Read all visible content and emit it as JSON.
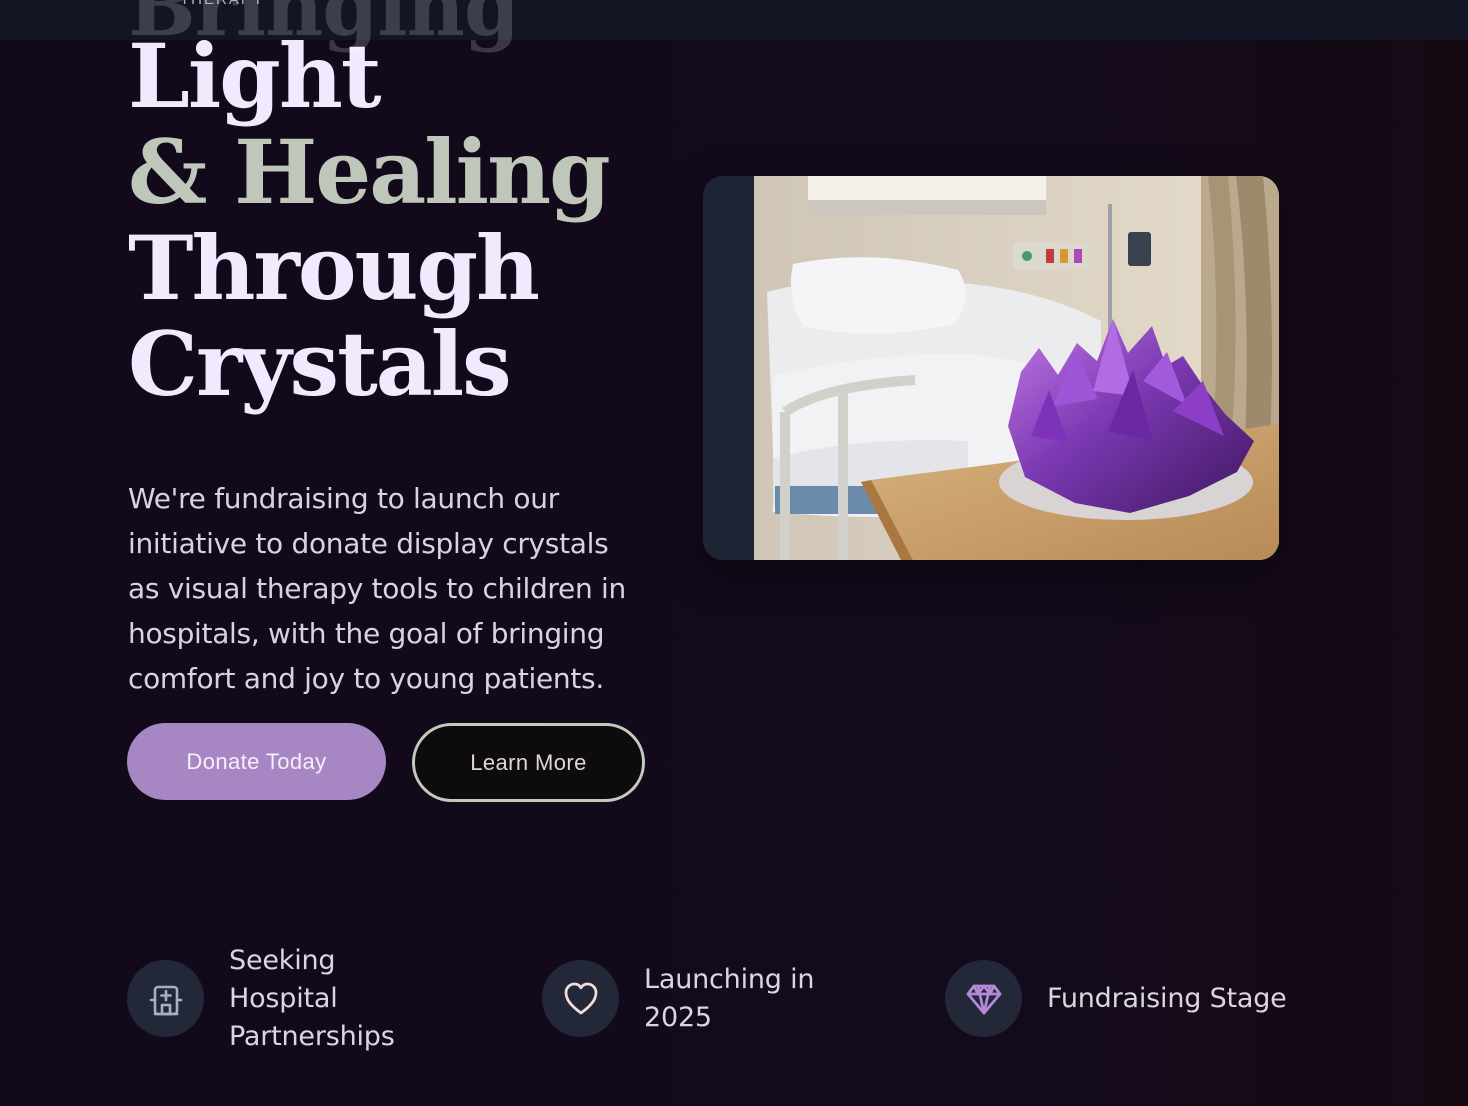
{
  "header": {
    "eyebrow": "THERAPY",
    "ghost_title": "Bringing"
  },
  "hero": {
    "title_lines": {
      "light": "Light",
      "healing": "& Healing",
      "through": "Through",
      "crystals": "Crystals"
    },
    "description": "We're fundraising to launch our initiative to donate display crystals as visual therapy tools to children in hospitals, with the goal of bringing comfort and joy to young patients.",
    "buttons": {
      "donate": "Donate Today",
      "learn_more": "Learn More"
    }
  },
  "features": [
    {
      "label": "Seeking Hospital Partnerships",
      "icon": "hospital-icon"
    },
    {
      "label": "Launching in 2025",
      "icon": "heart-icon"
    },
    {
      "label": "Fundraising Stage",
      "icon": "diamond-icon"
    }
  ],
  "colors": {
    "background": "#130a1b",
    "accent_purple": "#a687c4",
    "healing_sage": "#bfc7bb",
    "title_lavender": "#f3e9ff",
    "icon_circle": "#222838"
  }
}
